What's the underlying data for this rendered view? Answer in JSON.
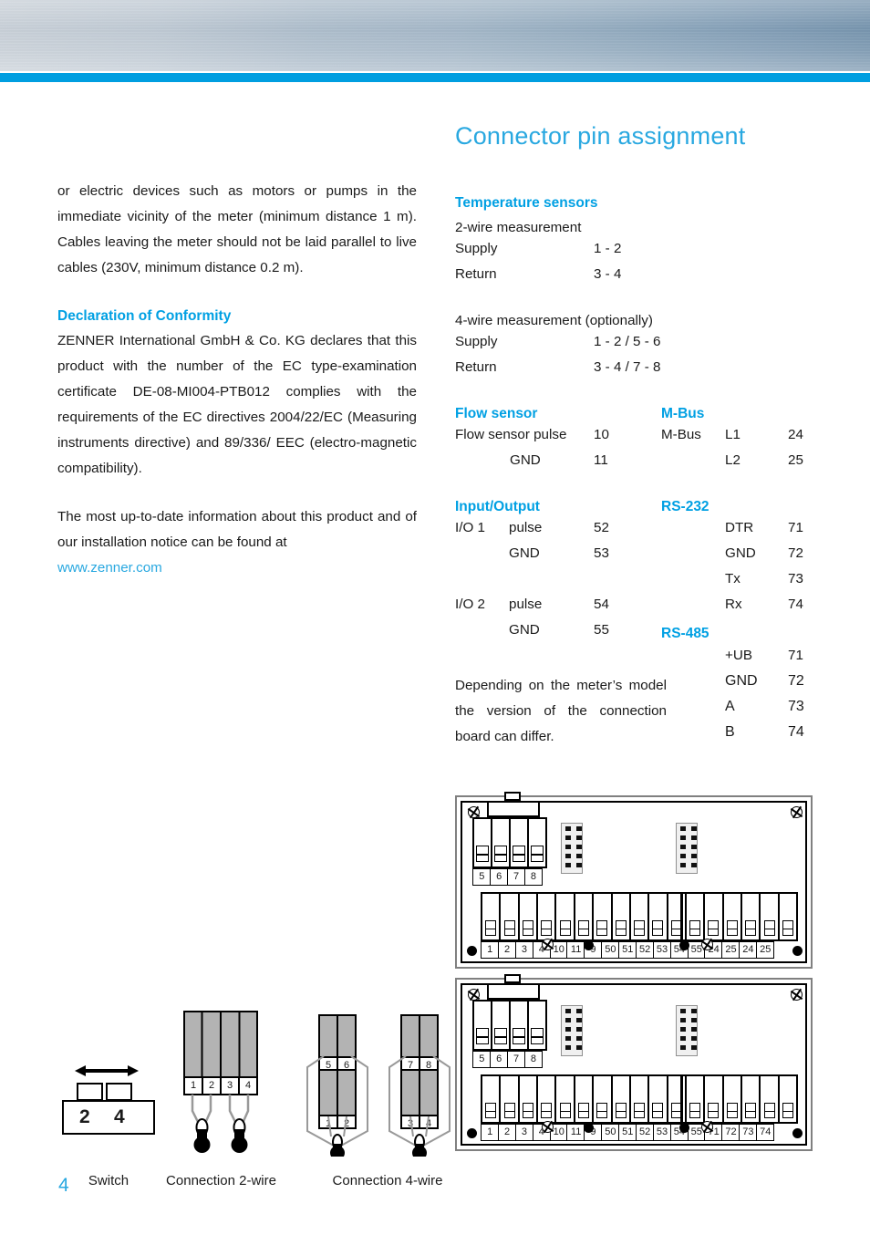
{
  "colors": {
    "accent": "#009ee0",
    "heading": "#00a0e3",
    "title": "#29a8e0",
    "text": "#1a1a1a"
  },
  "page": {
    "number": "4"
  },
  "left_column": {
    "intro_paragraph": "or electric devices such as motors or pumps in the immediate vicinity of the meter (minimum distance 1 m). Cables leaving the meter should not be laid parallel to live cables (230V, minimum distance 0.2 m).",
    "declaration_heading": "Declaration of Conformity",
    "declaration_paragraph": "ZENNER International GmbH & Co. KG declares that this product with the number of the EC type-examination certificate DE-08-MI004-PTB012 complies with the requirements of the EC directives 2004/22/EC (Measuring instruments directive) and 89/336/ EEC (electro-magnetic compatibility).",
    "info_paragraph": "The most up-to-date information about this product and of our installation notice can be found at",
    "link_text": "www.zenner.com"
  },
  "right_column": {
    "title": "Connector pin assignment",
    "temperature": {
      "heading": "Temperature sensors",
      "two_wire_label": "2-wire measurement",
      "two_wire_rows": [
        {
          "label": "Supply",
          "value": "1 - 2"
        },
        {
          "label": "Return",
          "value": "3 - 4"
        }
      ],
      "four_wire_label": "4-wire measurement (optionally)",
      "four_wire_rows": [
        {
          "label": "Supply",
          "value": "1 - 2 / 5 - 6"
        },
        {
          "label": "Return",
          "value": "3 - 4 / 7 - 8"
        }
      ]
    },
    "flow_sensor": {
      "heading": "Flow sensor",
      "rows": [
        {
          "label": "Flow sensor pulse",
          "value": "10"
        },
        {
          "label": "GND",
          "value": "11"
        }
      ]
    },
    "mbus": {
      "heading": "M-Bus",
      "rows": [
        {
          "group": "M-Bus",
          "label": "L1",
          "value": "24"
        },
        {
          "group": "",
          "label": "L2",
          "value": "25"
        }
      ]
    },
    "input_output": {
      "heading": "Input/Output",
      "rows": [
        {
          "group": "I/O 1",
          "label": "pulse",
          "value": "52"
        },
        {
          "group": "",
          "label": "GND",
          "value": "53"
        },
        {
          "group": "",
          "label": "",
          "value": ""
        },
        {
          "group": "I/O 2",
          "label": "pulse",
          "value": "54"
        },
        {
          "group": "",
          "label": "GND",
          "value": "55"
        }
      ],
      "note": "Depending on the meter’s model the version of the connection board can differ."
    },
    "rs232": {
      "heading": "RS-232",
      "rows": [
        {
          "label": "DTR",
          "value": "71"
        },
        {
          "label": "GND",
          "value": "72"
        },
        {
          "label": "Tx",
          "value": "73"
        },
        {
          "label": "Rx",
          "value": "74"
        }
      ]
    },
    "rs485": {
      "heading": "RS-485",
      "rows": [
        {
          "label": "+UB",
          "value": "71"
        },
        {
          "label": "GND",
          "value": "72"
        },
        {
          "label": "A",
          "value": "73"
        },
        {
          "label": "B",
          "value": "74"
        }
      ]
    }
  },
  "diagrams": {
    "switch": {
      "caption": "Switch",
      "keys": [
        "2",
        "4"
      ]
    },
    "connection_2wire": {
      "caption": "Connection 2-wire",
      "terminals": [
        "1",
        "2",
        "3",
        "4"
      ]
    },
    "connection_4wire": {
      "caption": "Connection 4-wire",
      "left_pair_top": [
        "5",
        "6"
      ],
      "left_pair_bottom": [
        "1",
        "2"
      ],
      "right_pair_top": [
        "7",
        "8"
      ],
      "right_pair_bottom": [
        "3",
        "4"
      ]
    }
  },
  "boards": [
    {
      "name": "connection-board-mbus",
      "top_terminals": [
        "5",
        "6",
        "7",
        "8"
      ],
      "bottom_terminals": [
        "1",
        "2",
        "3",
        "4",
        "10",
        "11",
        "9",
        "50",
        "51",
        "52",
        "53",
        "54",
        "55",
        "24",
        "25",
        "24",
        "25"
      ]
    },
    {
      "name": "connection-board-rs",
      "top_terminals": [
        "5",
        "6",
        "7",
        "8"
      ],
      "bottom_terminals": [
        "1",
        "2",
        "3",
        "4",
        "10",
        "11",
        "9",
        "50",
        "51",
        "52",
        "53",
        "54",
        "55",
        "71",
        "72",
        "73",
        "74"
      ]
    }
  ]
}
